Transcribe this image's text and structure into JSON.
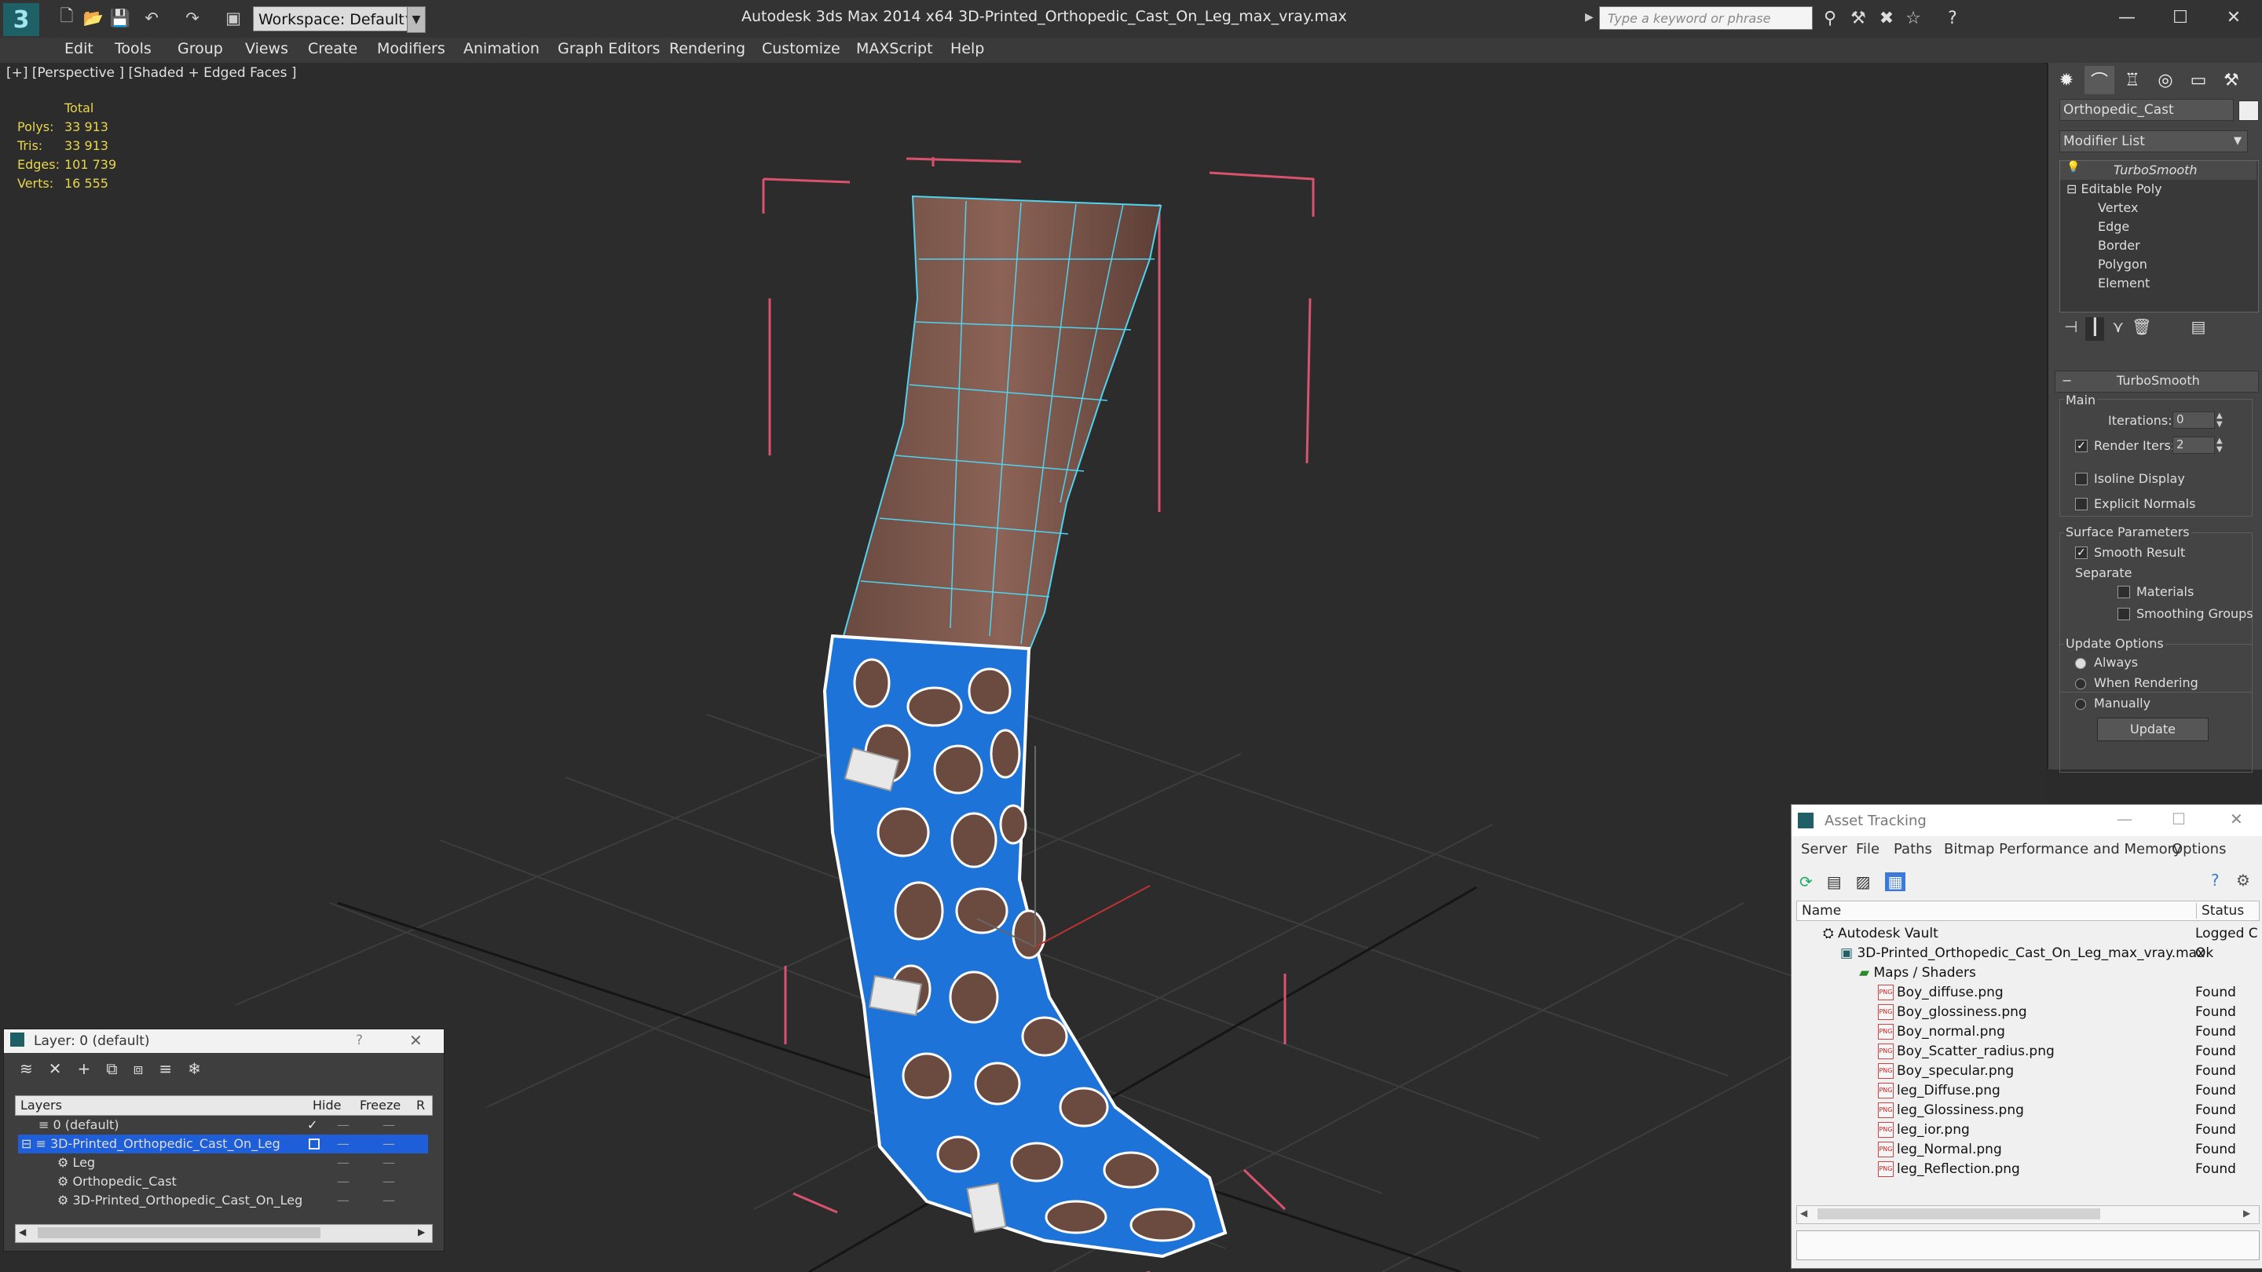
{
  "app": {
    "title": "Autodesk 3ds Max  2014 x64      3D-Printed_Orthopedic_Cast_On_Leg_max_vray.max",
    "logo_letter": "3",
    "workspace": "Workspace: Default",
    "search_placeholder": "Type a keyword or phrase"
  },
  "toolbar_icons": [
    "new-icon",
    "open-icon",
    "save-icon",
    "undo-icon",
    "redo-icon",
    "project-icon"
  ],
  "menu": [
    "Edit",
    "Tools",
    "Group",
    "Views",
    "Create",
    "Modifiers",
    "Animation",
    "Graph Editors",
    "Rendering",
    "Customize",
    "MAXScript",
    "Help"
  ],
  "viewport": {
    "label": "[+] [Perspective ] [Shaded + Edged Faces ]",
    "stats": {
      "header": "Total",
      "rows": [
        {
          "label": "Polys:",
          "value": "33 913"
        },
        {
          "label": "Tris:",
          "value": "33 913"
        },
        {
          "label": "Edges:",
          "value": "101 739"
        },
        {
          "label": "Verts:",
          "value": "16 555"
        }
      ]
    }
  },
  "command_panel": {
    "object_name": "Orthopedic_Cast",
    "modifier_list": "Modifier List",
    "stack": [
      "TurboSmooth",
      "Editable Poly",
      "Vertex",
      "Edge",
      "Border",
      "Polygon",
      "Element"
    ],
    "rollout_title": "TurboSmooth",
    "main_label": "Main",
    "iterations_label": "Iterations:",
    "iterations_value": "0",
    "render_iters_label": "Render Iters:",
    "render_iters_value": "2",
    "render_iters_checked": true,
    "isoline_label": "Isoline Display",
    "explicit_normals_label": "Explicit Normals",
    "surface_params_label": "Surface Parameters",
    "smooth_result_label": "Smooth Result",
    "separate_label": "Separate",
    "materials_label": "Materials",
    "smoothing_groups_label": "Smoothing Groups",
    "update_options_label": "Update Options",
    "always_label": "Always",
    "when_rendering_label": "When Rendering",
    "manually_label": "Manually",
    "update_button": "Update"
  },
  "layer_window": {
    "title": "Layer: 0 (default)",
    "help": "?",
    "col_layers": "Layers",
    "col_hide": "Hide",
    "col_freeze": "Freeze",
    "col_r": "R",
    "rows": [
      {
        "name": "0 (default)",
        "level": 0
      },
      {
        "name": "3D-Printed_Orthopedic_Cast_On_Leg",
        "level": 0
      },
      {
        "name": "Leg",
        "level": 1
      },
      {
        "name": "Orthopedic_Cast",
        "level": 1
      },
      {
        "name": "3D-Printed_Orthopedic_Cast_On_Leg",
        "level": 1
      }
    ]
  },
  "asset_tracking": {
    "title": "Asset Tracking",
    "menu": [
      "Server",
      "File",
      "Paths",
      "Bitmap Performance and Memory",
      "Options"
    ],
    "col_name": "Name",
    "col_status": "Status",
    "rows": [
      {
        "name": "Autodesk Vault",
        "status": "Logged C",
        "level": 0
      },
      {
        "name": "3D-Printed_Orthopedic_Cast_On_Leg_max_vray.max",
        "status": "Ok",
        "level": 1
      },
      {
        "name": "Maps / Shaders",
        "status": "",
        "level": 2
      },
      {
        "name": "Boy_diffuse.png",
        "status": "Found",
        "level": 3
      },
      {
        "name": "Boy_glossiness.png",
        "status": "Found",
        "level": 3
      },
      {
        "name": "Boy_normal.png",
        "status": "Found",
        "level": 3
      },
      {
        "name": "Boy_Scatter_radius.png",
        "status": "Found",
        "level": 3
      },
      {
        "name": "Boy_specular.png",
        "status": "Found",
        "level": 3
      },
      {
        "name": "leg_Diffuse.png",
        "status": "Found",
        "level": 3
      },
      {
        "name": "leg_Glossiness.png",
        "status": "Found",
        "level": 3
      },
      {
        "name": "leg_ior.png",
        "status": "Found",
        "level": 3
      },
      {
        "name": "leg_Normal.png",
        "status": "Found",
        "level": 3
      },
      {
        "name": "leg_Reflection.png",
        "status": "Found",
        "level": 3
      }
    ]
  },
  "colors": {
    "stats_yellow": "#e8d64a",
    "cast_blue": "#1e73d8",
    "wire_cyan": "#4fd3ef",
    "selection_blue": "#1e5ed8",
    "bbox_pink": "#d9536f"
  }
}
